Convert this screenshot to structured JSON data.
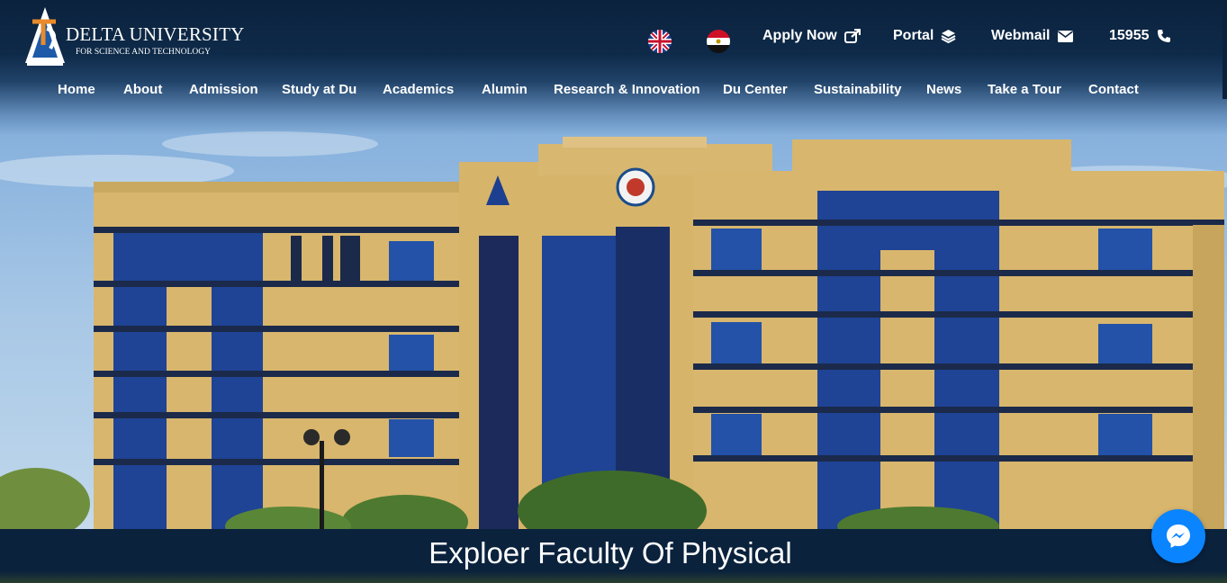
{
  "brand": {
    "name": "DELTA UNIVERSITY",
    "subtitle": "FOR SCIENCE AND TECHNOLOGY",
    "tagline": "DELTA UNIVERSITY"
  },
  "utility": {
    "lang_en_icon": "uk-flag-icon",
    "lang_ar_icon": "egypt-flag-icon",
    "apply_label": "Apply Now",
    "portal_label": "Portal",
    "webmail_label": "Webmail",
    "phone_label": "15955"
  },
  "nav": {
    "items": [
      "Home",
      "About",
      "Admission",
      "Study at Du",
      "Academics",
      "Alumin",
      "Research & Innovation",
      "Du Center",
      "Sustainability",
      "News",
      "Take a Tour",
      "Contact"
    ]
  },
  "hero": {
    "banner_title": "Exploer Faculty Of Physical"
  },
  "colors": {
    "header_bg": "#0b223d",
    "messenger": "#0a84ff",
    "building": "#d9b86e",
    "glass": "#1c3f8f"
  }
}
